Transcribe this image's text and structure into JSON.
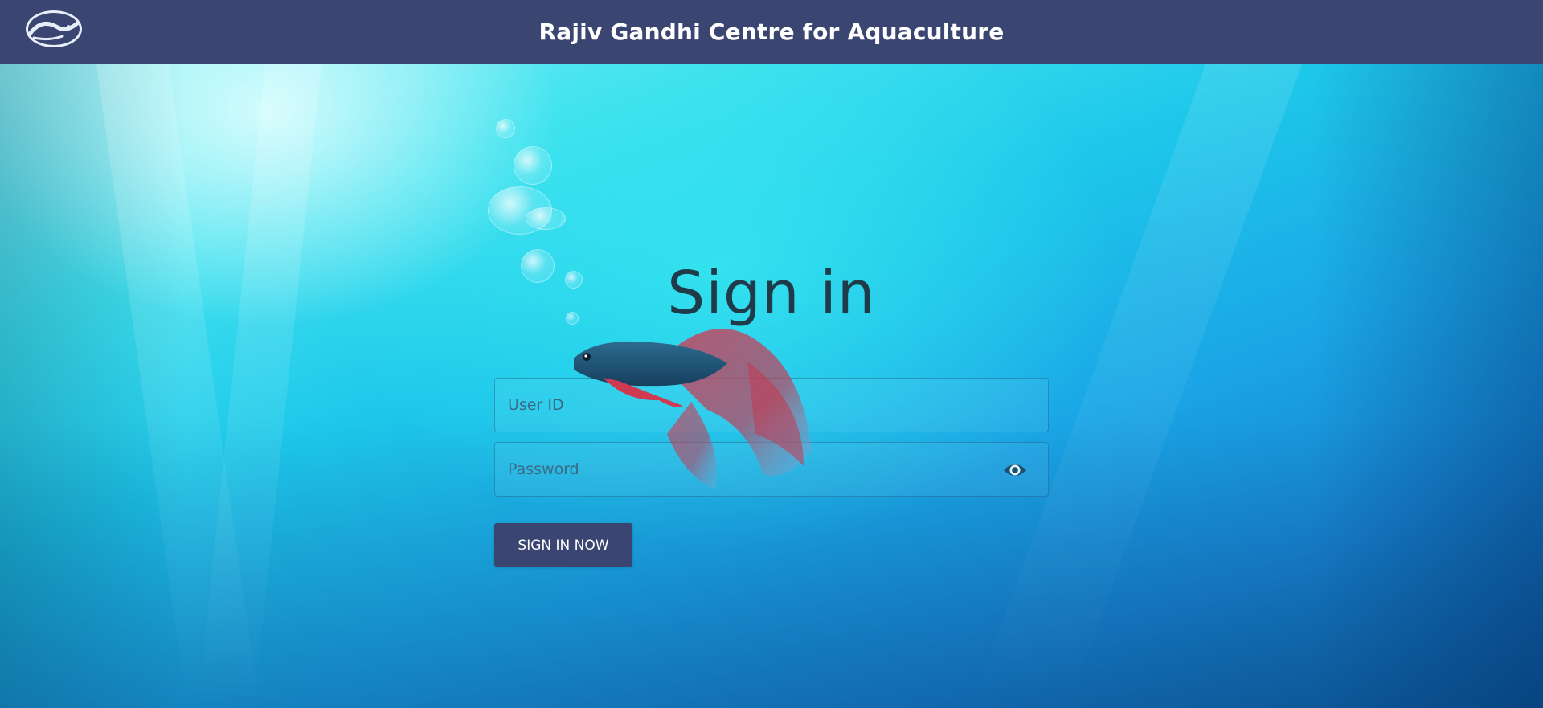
{
  "header": {
    "title": "Rajiv Gandhi Centre for Aquaculture",
    "logo_icon": "fish-emblem-logo",
    "background_color": "#3a4572"
  },
  "signin": {
    "heading": "Sign in",
    "user_id_placeholder": "User ID",
    "password_placeholder": "Password",
    "toggle_password_icon": "eye-icon",
    "submit_label": "SIGN IN NOW",
    "button_color": "#3a4572"
  },
  "background": {
    "scene": "underwater aquarium with betta fish and bubbles"
  }
}
